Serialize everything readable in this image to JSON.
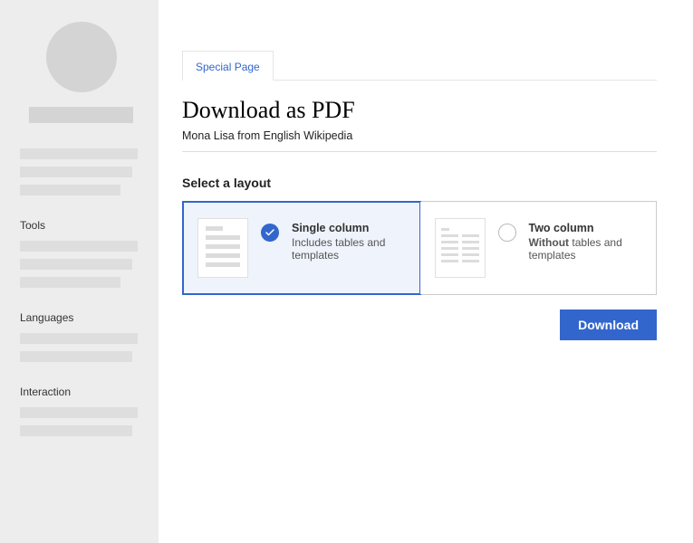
{
  "tab": {
    "label": "Special Page"
  },
  "page": {
    "title": "Download as PDF",
    "subtitle": "Mona Lisa from English Wikipedia"
  },
  "sidebar": {
    "sections": {
      "tools": "Tools",
      "languages": "Languages",
      "interaction": "Interaction"
    }
  },
  "layout": {
    "heading": "Select a layout",
    "options": [
      {
        "title": "Single column",
        "desc_plain": "Includes tables and templates"
      },
      {
        "title": "Two column",
        "desc_bold": "Without",
        "desc_rest": " tables and templates"
      }
    ]
  },
  "download_label": "Download"
}
